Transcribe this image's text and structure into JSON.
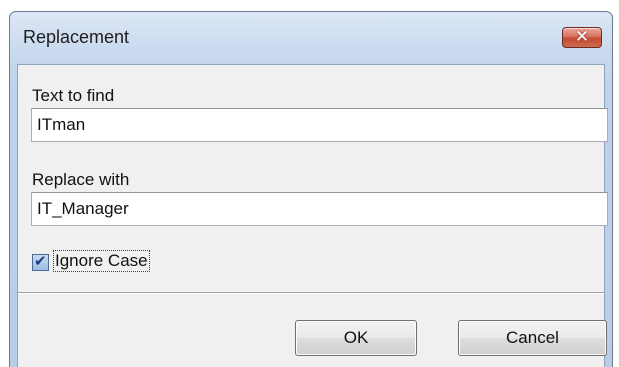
{
  "window": {
    "title": "Replacement"
  },
  "close_button": {
    "glyph": "✕",
    "icon": "close-icon"
  },
  "text_to_find": {
    "label": "Text to find",
    "value": "ITman"
  },
  "replace_with": {
    "label": "Replace with",
    "value": "IT_Manager"
  },
  "ignore_case": {
    "label": "Ignore Case",
    "checked": true
  },
  "buttons": {
    "ok": "OK",
    "cancel": "Cancel"
  },
  "colors": {
    "titlebar": "#c9d9ee",
    "close_button": "#c24a35",
    "dialog_body": "#f0f0f0"
  }
}
